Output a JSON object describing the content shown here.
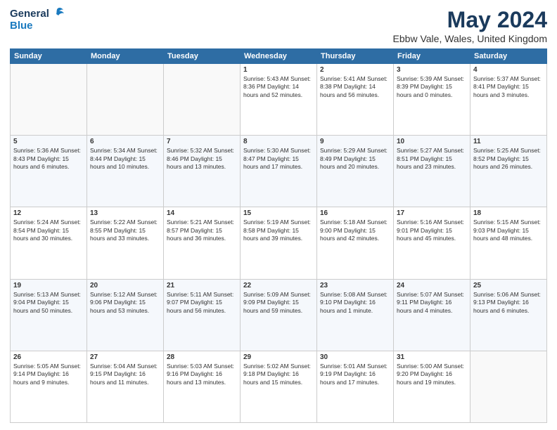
{
  "header": {
    "logo_general": "General",
    "logo_blue": "Blue",
    "month": "May 2024",
    "location": "Ebbw Vale, Wales, United Kingdom"
  },
  "days_of_week": [
    "Sunday",
    "Monday",
    "Tuesday",
    "Wednesday",
    "Thursday",
    "Friday",
    "Saturday"
  ],
  "weeks": [
    [
      {
        "day": "",
        "info": ""
      },
      {
        "day": "",
        "info": ""
      },
      {
        "day": "",
        "info": ""
      },
      {
        "day": "1",
        "info": "Sunrise: 5:43 AM\nSunset: 8:36 PM\nDaylight: 14 hours and 52 minutes."
      },
      {
        "day": "2",
        "info": "Sunrise: 5:41 AM\nSunset: 8:38 PM\nDaylight: 14 hours and 56 minutes."
      },
      {
        "day": "3",
        "info": "Sunrise: 5:39 AM\nSunset: 8:39 PM\nDaylight: 15 hours and 0 minutes."
      },
      {
        "day": "4",
        "info": "Sunrise: 5:37 AM\nSunset: 8:41 PM\nDaylight: 15 hours and 3 minutes."
      }
    ],
    [
      {
        "day": "5",
        "info": "Sunrise: 5:36 AM\nSunset: 8:43 PM\nDaylight: 15 hours and 6 minutes."
      },
      {
        "day": "6",
        "info": "Sunrise: 5:34 AM\nSunset: 8:44 PM\nDaylight: 15 hours and 10 minutes."
      },
      {
        "day": "7",
        "info": "Sunrise: 5:32 AM\nSunset: 8:46 PM\nDaylight: 15 hours and 13 minutes."
      },
      {
        "day": "8",
        "info": "Sunrise: 5:30 AM\nSunset: 8:47 PM\nDaylight: 15 hours and 17 minutes."
      },
      {
        "day": "9",
        "info": "Sunrise: 5:29 AM\nSunset: 8:49 PM\nDaylight: 15 hours and 20 minutes."
      },
      {
        "day": "10",
        "info": "Sunrise: 5:27 AM\nSunset: 8:51 PM\nDaylight: 15 hours and 23 minutes."
      },
      {
        "day": "11",
        "info": "Sunrise: 5:25 AM\nSunset: 8:52 PM\nDaylight: 15 hours and 26 minutes."
      }
    ],
    [
      {
        "day": "12",
        "info": "Sunrise: 5:24 AM\nSunset: 8:54 PM\nDaylight: 15 hours and 30 minutes."
      },
      {
        "day": "13",
        "info": "Sunrise: 5:22 AM\nSunset: 8:55 PM\nDaylight: 15 hours and 33 minutes."
      },
      {
        "day": "14",
        "info": "Sunrise: 5:21 AM\nSunset: 8:57 PM\nDaylight: 15 hours and 36 minutes."
      },
      {
        "day": "15",
        "info": "Sunrise: 5:19 AM\nSunset: 8:58 PM\nDaylight: 15 hours and 39 minutes."
      },
      {
        "day": "16",
        "info": "Sunrise: 5:18 AM\nSunset: 9:00 PM\nDaylight: 15 hours and 42 minutes."
      },
      {
        "day": "17",
        "info": "Sunrise: 5:16 AM\nSunset: 9:01 PM\nDaylight: 15 hours and 45 minutes."
      },
      {
        "day": "18",
        "info": "Sunrise: 5:15 AM\nSunset: 9:03 PM\nDaylight: 15 hours and 48 minutes."
      }
    ],
    [
      {
        "day": "19",
        "info": "Sunrise: 5:13 AM\nSunset: 9:04 PM\nDaylight: 15 hours and 50 minutes."
      },
      {
        "day": "20",
        "info": "Sunrise: 5:12 AM\nSunset: 9:06 PM\nDaylight: 15 hours and 53 minutes."
      },
      {
        "day": "21",
        "info": "Sunrise: 5:11 AM\nSunset: 9:07 PM\nDaylight: 15 hours and 56 minutes."
      },
      {
        "day": "22",
        "info": "Sunrise: 5:09 AM\nSunset: 9:09 PM\nDaylight: 15 hours and 59 minutes."
      },
      {
        "day": "23",
        "info": "Sunrise: 5:08 AM\nSunset: 9:10 PM\nDaylight: 16 hours and 1 minute."
      },
      {
        "day": "24",
        "info": "Sunrise: 5:07 AM\nSunset: 9:11 PM\nDaylight: 16 hours and 4 minutes."
      },
      {
        "day": "25",
        "info": "Sunrise: 5:06 AM\nSunset: 9:13 PM\nDaylight: 16 hours and 6 minutes."
      }
    ],
    [
      {
        "day": "26",
        "info": "Sunrise: 5:05 AM\nSunset: 9:14 PM\nDaylight: 16 hours and 9 minutes."
      },
      {
        "day": "27",
        "info": "Sunrise: 5:04 AM\nSunset: 9:15 PM\nDaylight: 16 hours and 11 minutes."
      },
      {
        "day": "28",
        "info": "Sunrise: 5:03 AM\nSunset: 9:16 PM\nDaylight: 16 hours and 13 minutes."
      },
      {
        "day": "29",
        "info": "Sunrise: 5:02 AM\nSunset: 9:18 PM\nDaylight: 16 hours and 15 minutes."
      },
      {
        "day": "30",
        "info": "Sunrise: 5:01 AM\nSunset: 9:19 PM\nDaylight: 16 hours and 17 minutes."
      },
      {
        "day": "31",
        "info": "Sunrise: 5:00 AM\nSunset: 9:20 PM\nDaylight: 16 hours and 19 minutes."
      },
      {
        "day": "",
        "info": ""
      }
    ]
  ]
}
